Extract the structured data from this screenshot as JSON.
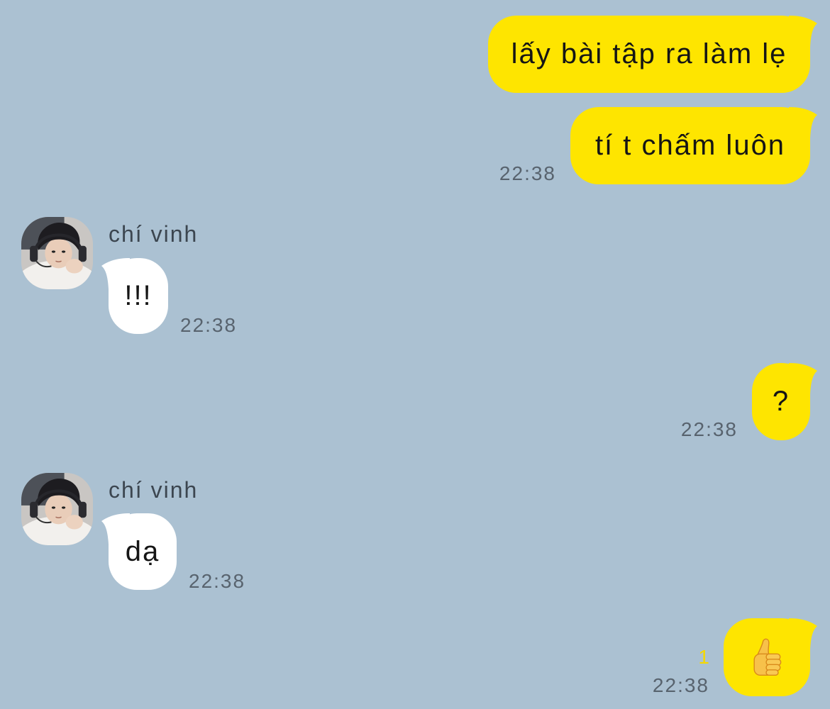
{
  "chat": {
    "colors": {
      "background": "#abc1d2",
      "my_bubble": "#fee500",
      "their_bubble": "#ffffff",
      "unread": "#f5d800"
    },
    "messages": [
      {
        "is_mine": true,
        "text": "lấy bài tập ra làm lẹ"
      },
      {
        "is_mine": true,
        "text": "tí t chấm luôn",
        "time": "22:38"
      },
      {
        "is_mine": false,
        "sender_name": "chí vinh",
        "avatar_icon": "avatar-photo",
        "text": "!!!",
        "time": "22:38"
      },
      {
        "is_mine": true,
        "text": "?",
        "time": "22:38"
      },
      {
        "is_mine": false,
        "sender_name": "chí vinh",
        "avatar_icon": "avatar-photo",
        "text": "dạ",
        "time": "22:38"
      },
      {
        "is_mine": true,
        "emoji_icon": "thumbs-up-emoji",
        "unread_count": 1,
        "time": "22:38"
      }
    ]
  }
}
